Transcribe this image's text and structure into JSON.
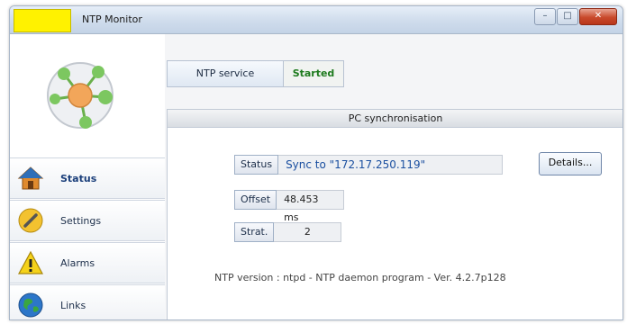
{
  "window": {
    "title": "NTP Monitor",
    "min_glyph": "–",
    "max_glyph": "□",
    "close_glyph": "✕"
  },
  "service": {
    "label": "NTP service",
    "state": "Started"
  },
  "panel": {
    "title": "PC synchronisation",
    "status_label": "Status",
    "status_value": "Sync to \"172.17.250.119\"",
    "details_button": "Details...",
    "offset_label": "Offset",
    "offset_value": "48.453 ms",
    "strat_label": "Strat.",
    "strat_value": "2",
    "version_text": "NTP version :  ntpd - NTP daemon program - Ver. 4.2.7p128"
  },
  "nav": [
    {
      "label": "Status",
      "icon": "house-icon"
    },
    {
      "label": "Settings",
      "icon": "wrench-icon"
    },
    {
      "label": "Alarms",
      "icon": "warning-icon"
    },
    {
      "label": "Links",
      "icon": "globe-icon"
    }
  ],
  "colors": {
    "accent": "#1a4fa0",
    "started": "#1d7a1d",
    "title_icon": "#fff200"
  }
}
